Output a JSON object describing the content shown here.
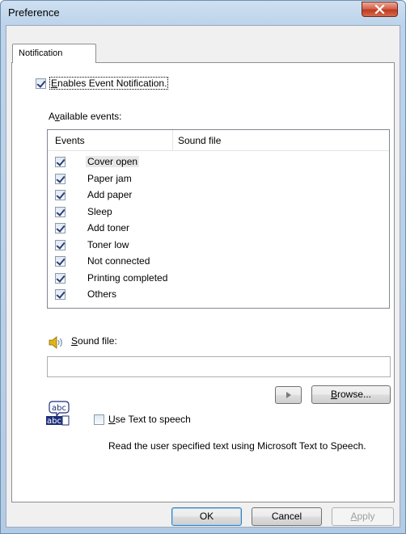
{
  "window": {
    "title": "Preference"
  },
  "tabs": [
    {
      "label": "Notification"
    }
  ],
  "notification": {
    "enable_checkbox": {
      "label": "Enables Event Notification.",
      "checked": true
    },
    "available_events_label": "Available events:",
    "columns": {
      "events": "Events",
      "sound_file": "Sound file"
    },
    "events": [
      {
        "name": "Cover open",
        "checked": true,
        "selected": true
      },
      {
        "name": "Paper jam",
        "checked": true
      },
      {
        "name": "Add paper",
        "checked": true
      },
      {
        "name": "Sleep",
        "checked": true
      },
      {
        "name": "Add toner",
        "checked": true
      },
      {
        "name": "Toner low",
        "checked": true
      },
      {
        "name": "Not connected",
        "checked": true
      },
      {
        "name": "Printing completed",
        "checked": true
      },
      {
        "name": "Others",
        "checked": true
      }
    ],
    "sound_file_label": "Sound file:",
    "sound_file_value": "",
    "browse_label": "Browse...",
    "tts_icon_text": "abc",
    "tts_checkbox": {
      "label": "Use Text to speech",
      "checked": false
    },
    "tts_description": "Read the user specified text using Microsoft Text to Speech."
  },
  "footer": {
    "ok": "OK",
    "cancel": "Cancel",
    "apply": "Apply"
  },
  "colors": {
    "titlebar": "#bcd3ea",
    "close": "#c0391f",
    "panel": "#ffffff",
    "dialog": "#f0f0f0"
  },
  "icons": {
    "close": "close-icon",
    "speaker": "speaker-icon",
    "play": "play-icon",
    "tts": "text-to-speech-icon"
  }
}
